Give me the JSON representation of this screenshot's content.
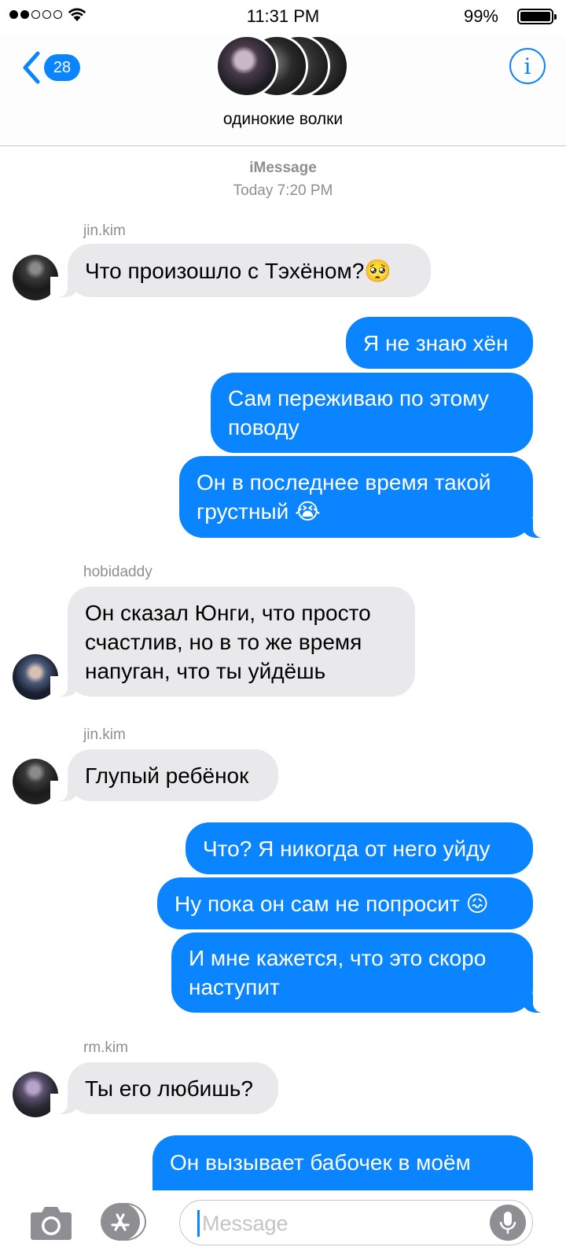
{
  "status_bar": {
    "time": "11:31 PM",
    "battery_percent": "99%",
    "signal_bars_filled": 2,
    "signal_bars_total": 5
  },
  "header": {
    "back_count": "28",
    "group_name": "одинокие волки",
    "info_label": "i"
  },
  "meta": {
    "service": "iMessage",
    "timestamp": "Today 7:20 PM"
  },
  "messages": [
    {
      "sender": "jin.kim",
      "direction": "incoming",
      "text": "Что произошло с Тэхёном?🥺"
    },
    {
      "direction": "outgoing",
      "text": "Я не знаю хён"
    },
    {
      "direction": "outgoing",
      "text": "Сам переживаю по этому поводу"
    },
    {
      "direction": "outgoing",
      "text": "Он в последнее время такой грустный 😭"
    },
    {
      "sender": "hobidaddy",
      "direction": "incoming",
      "text": "Он сказал Юнги, что просто счастлив, но в то же время напуган, что ты уйдёшь"
    },
    {
      "sender": "jin.kim",
      "direction": "incoming",
      "text": "Глупый ребёнок"
    },
    {
      "direction": "outgoing",
      "text": "Что? Я никогда от него уйду"
    },
    {
      "direction": "outgoing",
      "text": "Ну пока он сам не попросит 😖"
    },
    {
      "direction": "outgoing",
      "text": "И мне кажется, что это скоро наступит"
    },
    {
      "sender": "rm.kim",
      "direction": "incoming",
      "text": "Ты его любишь?"
    },
    {
      "direction": "outgoing",
      "text": "Он вызывает бабочек в моём"
    }
  ],
  "input": {
    "placeholder": "Message"
  },
  "colors": {
    "accent": "#0b84ff",
    "incoming_bubble": "#e9e9eb",
    "secondary_text": "#8e8e93"
  },
  "icons": {
    "back": "chevron-left-icon",
    "info": "info-icon",
    "camera": "camera-icon",
    "apps": "app-store-icon",
    "mic": "microphone-icon"
  }
}
